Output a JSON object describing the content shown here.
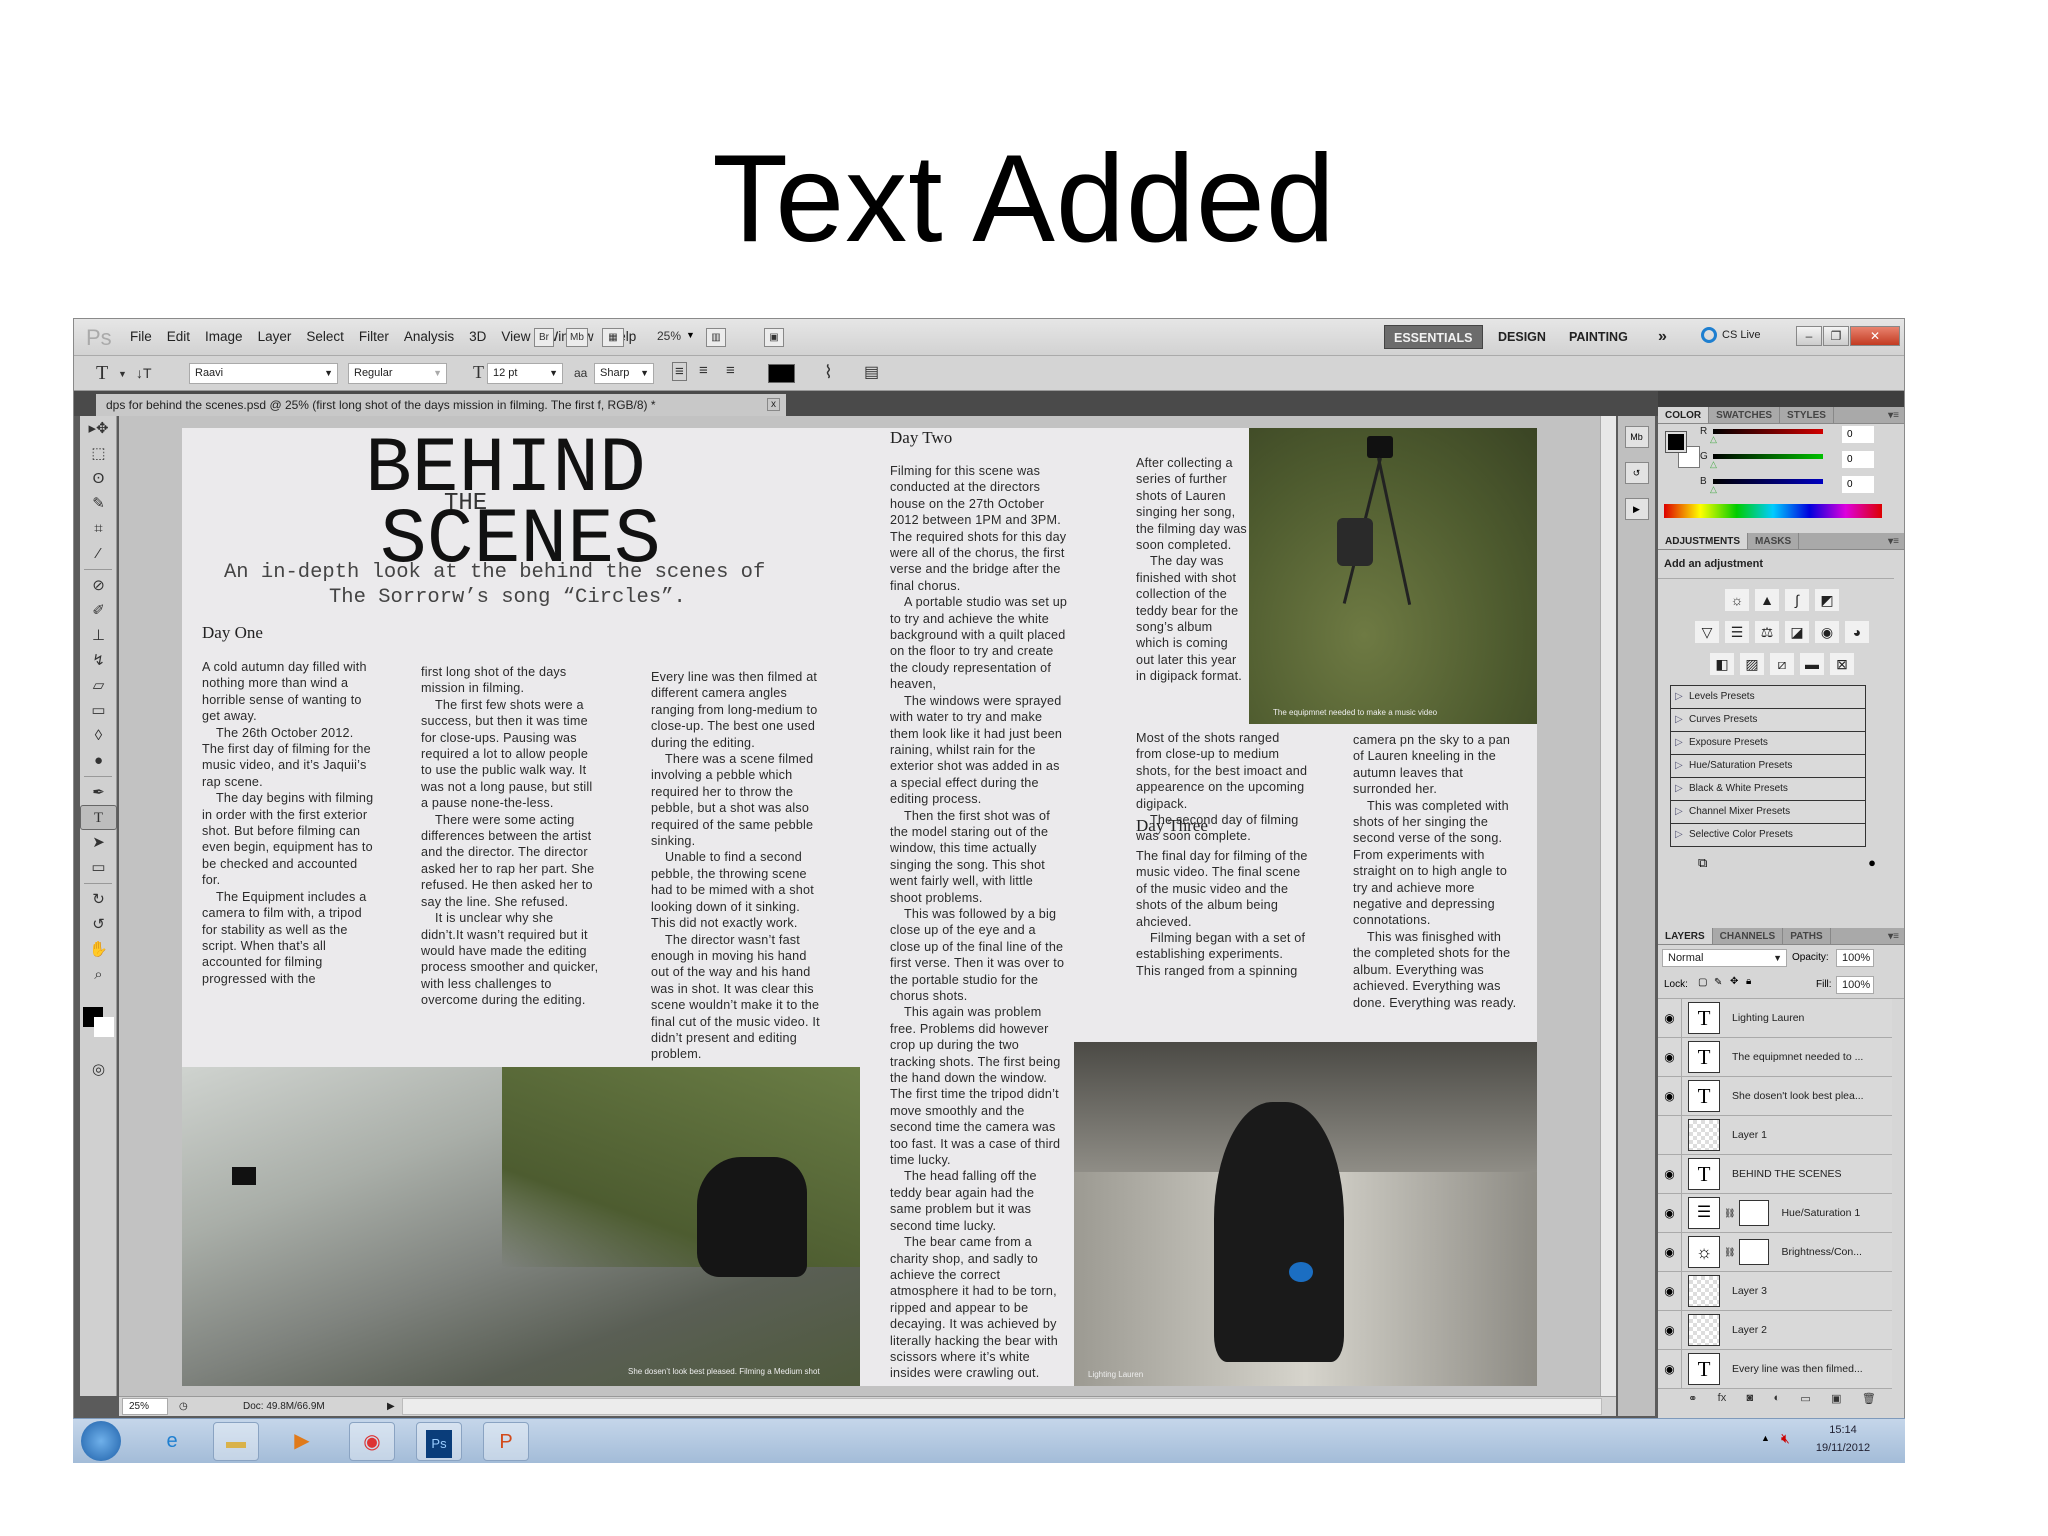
{
  "slide": {
    "title": "Text Added"
  },
  "app": {
    "logo": "Ps",
    "menu": [
      "File",
      "Edit",
      "Image",
      "Layer",
      "Select",
      "Filter",
      "Analysis",
      "3D",
      "View",
      "Window",
      "Help"
    ],
    "bridge": "Br",
    "minibridge": "Mb",
    "zoom_select": "25%",
    "workspaces": [
      "ESSENTIALS",
      "DESIGN",
      "PAINTING"
    ],
    "more_workspaces": "»",
    "cs_live": "CS Live"
  },
  "options": {
    "font_family": "Raavi",
    "font_style": "Regular",
    "font_size": "12 pt",
    "antialias_icon": "aa",
    "antialias": "Sharp",
    "text_color": "#000000"
  },
  "document": {
    "tab_title": "dps for behind the scenes.psd @ 25% (first long shot of the days mission in filming.   The first f, RGB/8) *",
    "close": "x",
    "headline_1": "BEHIND",
    "headline_the": "THE",
    "headline_2": "SCENES",
    "subtitle_1": "An in-depth look at the behind the scenes of",
    "subtitle_2": "The Sorrorw’s song “Circles”.",
    "day_one": "Day One",
    "day_two": "Day Two",
    "day_three": "Day Three",
    "columns": [
      [
        "A cold autumn day filled with nothing more than wind a horrible sense of wanting to get away.",
        "The 26th October 2012. The first day of filming for the music video, and it’s Jaquii’s rap scene.",
        "The day begins with filming in order with the first exterior shot. But before filming can even begin, equipment has to be checked and accounted for.",
        "The Equipment includes a camera to film with, a tripod for stability as well as the script. When that’s all accounted for filming progressed with the"
      ],
      [
        "first long shot of the days mission in filming.",
        "The first few shots were a success, but then it was time for close-ups. Pausing was required a lot to allow people to use the public walk way. It was not a long pause, but still a pause none-the-less.",
        "There were some acting differences between the artist and the director. The director asked her to rap her part. She refused. He then asked her to say the line. She refused.",
        "It is unclear why she didn’t.It wasn’t required but it would have made the editing process smoother and quicker, with less challenges to overcome during the editing."
      ],
      [
        "Every line was then filmed at different camera angles ranging from long-medium to close-up. The best one used during the editing.",
        "There was a scene filmed involving a pebble which required her to throw the pebble, but a shot was also required of the same pebble sinking.",
        "Unable to find a second pebble, the throwing scene had to be mimed with a shot looking down of it sinking. This did not exactly work.",
        "The director wasn’t fast enough in moving his hand out of the way and his hand was in shot. It was clear this scene wouldn’t make it to the final cut of the music video. It didn’t present and editing problem."
      ],
      [
        "Filming for this scene was conducted at the directors house on the 27th October 2012 between 1PM and 3PM. The required shots for this day were all of the chorus, the first verse and the bridge after the final chorus.",
        "A portable studio was set up to try and achieve the white background with a quilt placed on the floor to try and create the cloudy representation of heaven,",
        "The windows were sprayed with water to try and make them look like it had just been raining, whilst rain for the exterior shot was added in as a special effect during the editing process.",
        "Then the first shot was of the model staring out of the window, this time actually singing the song. This shot went fairly well, with little shoot problems.",
        "This was followed by a big close up of the eye and a close up of the final line of the first verse. Then it was over to the portable studio for the chorus shots.",
        "This again was problem free. Problems did however crop up during the two tracking shots. The first being the hand down the window. The first time the tripod didn’t move smoothly and the second time the camera was too fast. It was a case of third time lucky.",
        "The head falling off the teddy bear again had the same problem but it was second time lucky.",
        "The bear came from a charity shop, and sadly to achieve the correct atmosphere it had to be torn, ripped and appear to be decaying. It was achieved by literally hacking the bear with scissors where it’s white insides were crawling out."
      ],
      [
        "After collecting a series of further shots of Lauren singing her song, the filming day was soon completed.",
        "The day was finished with shot collection of the teddy bear for the song’s album which is coming out later this year in digipack format."
      ],
      [
        "Most of the shots ranged from close-up to medium shots, for the best imoact and appearence on the upcoming digipack.",
        "The second day of filming was soon complete."
      ],
      [
        "The final day for filming of the music video. The final scene of the music video and the shots of the album being ahcieved.",
        "Filming began with a set of establishing experiments. This ranged from a spinning"
      ],
      [
        "camera pn the sky to a pan of Lauren kneeling in the autumn leaves that surronded her.",
        "This was completed with shots of her singing the second verse of the song. From experiments with straight on to high angle to try and achieve more negative and depressing connotations.",
        "This was finisghed with the completed shots for the album. Everything was achieved. Everything was done. Everything was ready."
      ]
    ],
    "captions": {
      "equipment": "The equipmnet needed to make a music video",
      "lake": "She dosen’t look best pleased. Filming a Medium shot",
      "lighting": "Lighting Lauren"
    }
  },
  "status": {
    "zoom": "25%",
    "doc_info": "Doc: 49.8M/66.9M"
  },
  "panels": {
    "color_tabs": [
      "COLOR",
      "SWATCHES",
      "STYLES"
    ],
    "channels": [
      {
        "label": "R",
        "value": "0",
        "color": "#d00000"
      },
      {
        "label": "G",
        "value": "0",
        "color": "#00c000"
      },
      {
        "label": "B",
        "value": "0",
        "color": "#0000c0"
      }
    ],
    "adjust_tabs": [
      "ADJUSTMENTS",
      "MASKS"
    ],
    "add_adjustment": "Add an adjustment",
    "presets": [
      "Levels Presets",
      "Curves Presets",
      "Exposure Presets",
      "Hue/Saturation Presets",
      "Black & White Presets",
      "Channel Mixer Presets",
      "Selective Color Presets"
    ],
    "layer_tabs": [
      "LAYERS",
      "CHANNELS",
      "PATHS"
    ],
    "blend_mode": "Normal",
    "opacity_label": "Opacity:",
    "opacity": "100%",
    "lock_label": "Lock:",
    "fill_label": "Fill:",
    "fill": "100%",
    "layers": [
      {
        "name": "Lighting Lauren",
        "type": "text",
        "visible": true
      },
      {
        "name": "The equipmnet needed to ...",
        "type": "text",
        "visible": true
      },
      {
        "name": "She dosen't look best plea...",
        "type": "text",
        "visible": true
      },
      {
        "name": "Layer 1",
        "type": "raster",
        "visible": false
      },
      {
        "name": "BEHIND  THE  SCENES",
        "type": "text",
        "visible": true
      },
      {
        "name": "Hue/Saturation 1",
        "type": "hue",
        "visible": true
      },
      {
        "name": "Brightness/Con...",
        "type": "brightness",
        "visible": true
      },
      {
        "name": "Layer 3",
        "type": "raster",
        "visible": true
      },
      {
        "name": "Layer 2",
        "type": "raster",
        "visible": true
      },
      {
        "name": "Every line was then filmed...",
        "type": "text",
        "visible": true
      }
    ]
  },
  "taskbar": {
    "time": "15:14",
    "date": "19/11/2012",
    "ps_label": "Ps"
  }
}
